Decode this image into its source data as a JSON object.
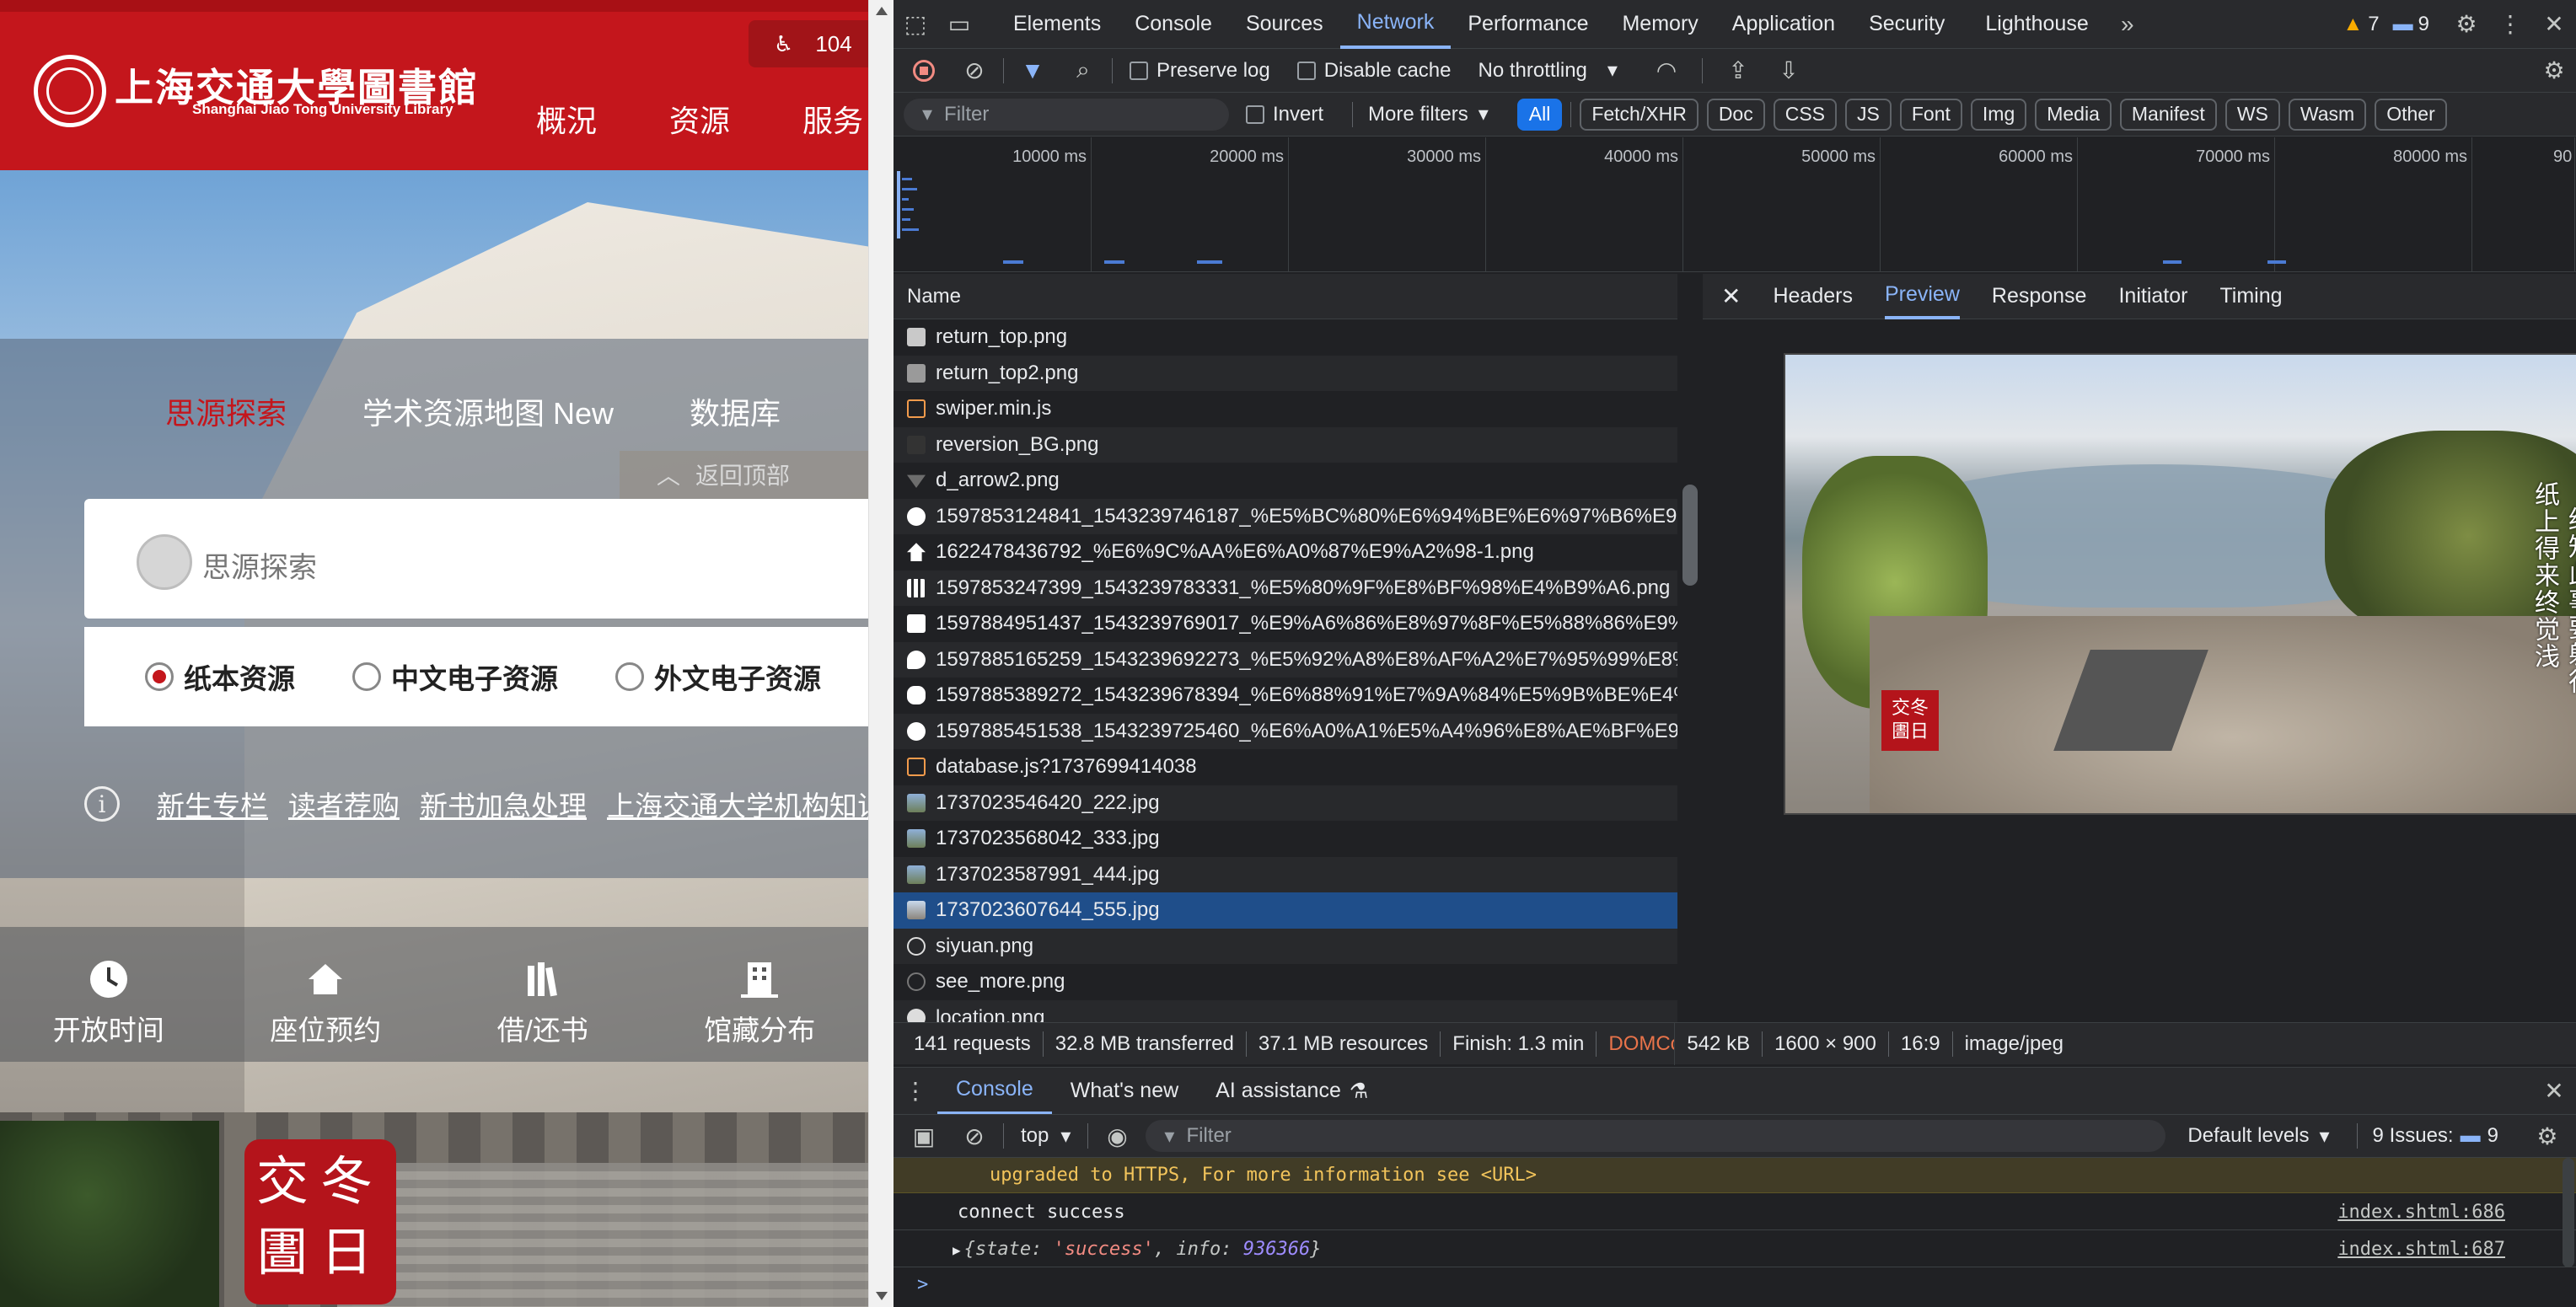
{
  "site": {
    "logo_cn": "上海交通大學圖書館",
    "logo_en": "Shanghai Jiao Tong University Library",
    "top_count": "104",
    "nav": [
      "概況",
      "资源",
      "服务"
    ],
    "search_tabs": [
      "思源探索",
      "学术资源地图 New",
      "数据库"
    ],
    "back_top": "返回顶部",
    "search_placeholder": "思源探索",
    "radios": [
      "纸本资源",
      "中文电子资源",
      "外文电子资源"
    ],
    "links": [
      "新生专栏",
      "读者荐购",
      "新书加急处理",
      "上海交通大学机构知识库"
    ],
    "quick": [
      "开放时间",
      "座位预约",
      "借/还书",
      "馆藏分布"
    ],
    "seal_text": "交冬\n圕日"
  },
  "devtools": {
    "tabs": [
      "Elements",
      "Console",
      "Sources",
      "Network",
      "Performance",
      "Memory",
      "Application",
      "Security",
      "Lighthouse"
    ],
    "active_tab": "Network",
    "warnings": "7",
    "messages": "9",
    "toolbar": {
      "preserve_log": "Preserve log",
      "disable_cache": "Disable cache",
      "throttling": "No throttling"
    },
    "filter": {
      "placeholder": "Filter",
      "invert": "Invert",
      "more_filters": "More filters",
      "types": [
        "All",
        "Fetch/XHR",
        "Doc",
        "CSS",
        "JS",
        "Font",
        "Img",
        "Media",
        "Manifest",
        "WS",
        "Wasm",
        "Other"
      ]
    },
    "timeline_ticks": [
      "10000 ms",
      "20000 ms",
      "30000 ms",
      "40000 ms",
      "50000 ms",
      "60000 ms",
      "70000 ms",
      "80000 ms",
      "90"
    ],
    "list_header": "Name",
    "requests": [
      "return_top.png",
      "return_top2.png",
      "swiper.min.js",
      "reversion_BG.png",
      "d_arrow2.png",
      "1597853124841_1543239746187_%E5%BC%80%E6%94%BE%E6%97%B6%E9%9...",
      "1622478436792_%E6%9C%AA%E6%A0%87%E9%A2%98-1.png",
      "1597853247399_1543239783331_%E5%80%9F%E8%BF%98%E4%B9%A6.png",
      "1597884951437_1543239769017_%E9%A6%86%E8%97%8F%E5%88%86%E9%8...",
      "1597885165259_1543239692273_%E5%92%A8%E8%AF%A2%E7%95%99%E8%A...",
      "1597885389272_1543239678394_%E6%88%91%E7%9A%84%E5%9B%BE%E4%B...",
      "1597885451538_1543239725460_%E6%A0%A1%E5%A4%96%E8%AE%BF%E9%9...",
      "database.js?1737699414038",
      "1737023546420_222.jpg",
      "1737023568042_333.jpg",
      "1737023587991_444.jpg",
      "1737023607644_555.jpg",
      "siyuan.png",
      "see_more.png",
      "location.png"
    ],
    "selected_request": "1737023607644_555.jpg",
    "preview_tabs": [
      "Headers",
      "Preview",
      "Response",
      "Initiator",
      "Timing"
    ],
    "active_preview_tab": "Preview",
    "photo_text_1": "纸上得来终觉浅",
    "photo_text_2": "绝知此事要躬行",
    "photo_seal": "交冬\n圕日",
    "status": {
      "requests": "141 requests",
      "transferred": "32.8 MB transferred",
      "resources": "37.1 MB resources",
      "finish": "Finish: 1.3 min",
      "domcontent": "DOMCo",
      "size": "542 kB",
      "dims": "1600 × 900",
      "ratio": "16:9",
      "mime": "image/jpeg"
    },
    "drawer_tabs": [
      "Console",
      "What's new",
      "AI assistance"
    ],
    "console": {
      "context": "top",
      "filter_placeholder": "Filter",
      "levels": "Default levels",
      "issues_label": "9 Issues:",
      "issues_count": "9",
      "log_warn": "upgraded to HTTPS, For more information see <URL>",
      "log1": "connect success",
      "log1_src": "index.shtml:686",
      "log2_prefix": "{state: ",
      "log2_state": "'success'",
      "log2_mid": ", info: ",
      "log2_info": "936366",
      "log2_suffix": "}",
      "log2_src": "index.shtml:687",
      "prompt": ">"
    }
  }
}
